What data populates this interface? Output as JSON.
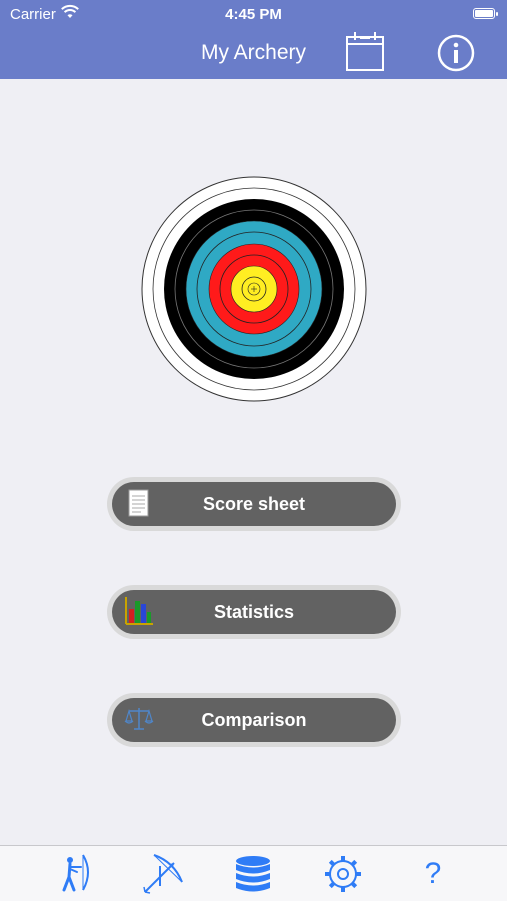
{
  "status_bar": {
    "carrier": "Carrier",
    "time": "4:45 PM"
  },
  "nav": {
    "title": "My Archery",
    "calendar_icon": "calendar-icon",
    "info_icon": "info-icon"
  },
  "colors": {
    "nav_bar": "#6a7dc9",
    "background": "#efeff4",
    "button_fill": "#626262",
    "button_rim": "#d9d9d9",
    "tab_tint": "#2f7cf6"
  },
  "target": {
    "rings": [
      "white",
      "black",
      "blue",
      "red",
      "gold"
    ]
  },
  "buttons": {
    "score_sheet": {
      "label": "Score sheet",
      "icon": "document-icon"
    },
    "statistics": {
      "label": "Statistics",
      "icon": "bar-chart-icon"
    },
    "comparison": {
      "label": "Comparison",
      "icon": "scale-icon"
    }
  },
  "tabbar": {
    "items": [
      {
        "icon": "archer-icon"
      },
      {
        "icon": "bow-arrow-icon"
      },
      {
        "icon": "database-icon"
      },
      {
        "icon": "gear-icon"
      },
      {
        "icon": "help-icon",
        "label": "?"
      }
    ]
  }
}
